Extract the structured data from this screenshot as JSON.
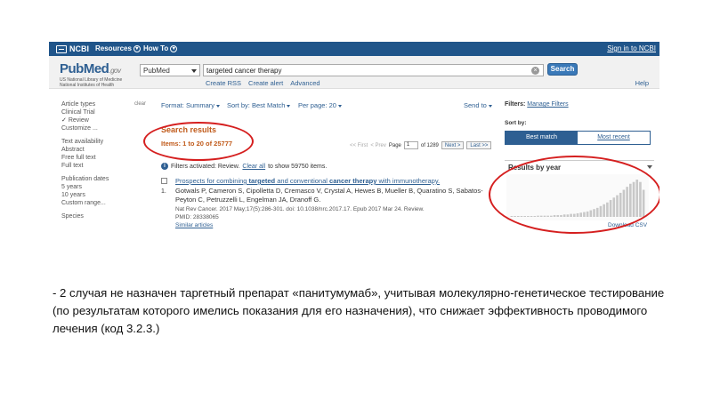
{
  "ncbi": {
    "logo_text": "NCBI",
    "menu_resources": "Resources",
    "menu_howto": "How To",
    "signin": "Sign in to NCBI"
  },
  "pubmed": {
    "logo_pub": "Pub",
    "logo_med": "Med",
    "logo_gov": ".gov",
    "sub_line1": "US National Library of Medicine",
    "sub_line2": "National Institutes of Health"
  },
  "search": {
    "database": "PubMed",
    "query": "targeted cancer therapy",
    "button": "Search",
    "links": [
      "Create RSS",
      "Create alert",
      "Advanced"
    ],
    "help": "Help"
  },
  "sidebar": {
    "clear": "clear",
    "article_types": {
      "heading": "Article types",
      "items": [
        "Clinical Trial",
        "Review",
        "Customize ..."
      ]
    },
    "text_availability": {
      "heading": "Text availability",
      "items": [
        "Abstract",
        "Free full text",
        "Full text"
      ]
    },
    "publication_dates": {
      "heading": "Publication dates",
      "items": [
        "5 years",
        "10 years",
        "Custom range..."
      ]
    },
    "species": {
      "heading": "Species"
    }
  },
  "toolbar": {
    "format_label": "Format:",
    "format_value": "Summary",
    "sort_label": "Sort by:",
    "sort_value": "Best Match",
    "perpage_label": "Per page:",
    "perpage_value": "20",
    "send_to": "Send to"
  },
  "results": {
    "title": "Search results",
    "items": "Items: 1 to 20 of 25777",
    "pager": {
      "first": "<< First",
      "prev": "< Prev",
      "page_label": "Page",
      "page_value": "1",
      "of": "of 1289",
      "next": "Next >",
      "last": "Last >>"
    },
    "filter_info_pre": "Filters activated: Review.",
    "filter_info_link": "Clear all",
    "filter_info_post": "to show 59750 items.",
    "first": {
      "number": "1.",
      "title_1": "Prospects for combining ",
      "title_2": "targeted",
      "title_3": " and conventional ",
      "title_4": "cancer therapy",
      "title_5": " with immunotherapy.",
      "authors": "Gotwals P, Cameron S, Cipolletta D, Cremasco V, Crystal A, Hewes B, Mueller B, Quaratino S, Sabatos-Peyton C, Petruzzelli L, Engelman JA, Dranoff G.",
      "citation": "Nat Rev Cancer. 2017 May;17(5):286-301. doi: 10.1038/nrc.2017.17. Epub 2017 Mar 24. Review.",
      "pmid": "PMID: 28338065",
      "similar": "Similar articles"
    }
  },
  "right_panel": {
    "filters_label": "Filters:",
    "manage_filters": "Manage Filters",
    "sort_by": "Sort by:",
    "best_match": "Best match",
    "most_recent": "Most recent",
    "results_by_year": "Results by year",
    "download_csv": "Download CSV"
  },
  "chart_data": {
    "type": "bar",
    "title": "Results by year",
    "values": [
      1,
      1,
      1,
      1,
      1,
      1,
      1,
      1,
      2,
      2,
      2,
      2,
      2,
      3,
      3,
      3,
      4,
      4,
      5,
      5,
      6,
      7,
      8,
      9,
      11,
      13,
      15,
      18,
      21,
      24,
      28,
      32,
      36,
      40,
      45,
      50,
      55,
      58,
      62,
      58,
      45
    ],
    "ylim": [
      0,
      65
    ]
  },
  "annotation": {
    "color": "#d51f1f"
  },
  "caption": {
    "text": "- 2 случая не назначен таргетный препарат «панитумумаб», учитывая молекулярно-генетическое тестирование (по результатам которого имелись показания для его назначения), что снижает эффективность проводимого лечения (код 3.2.3.)"
  }
}
